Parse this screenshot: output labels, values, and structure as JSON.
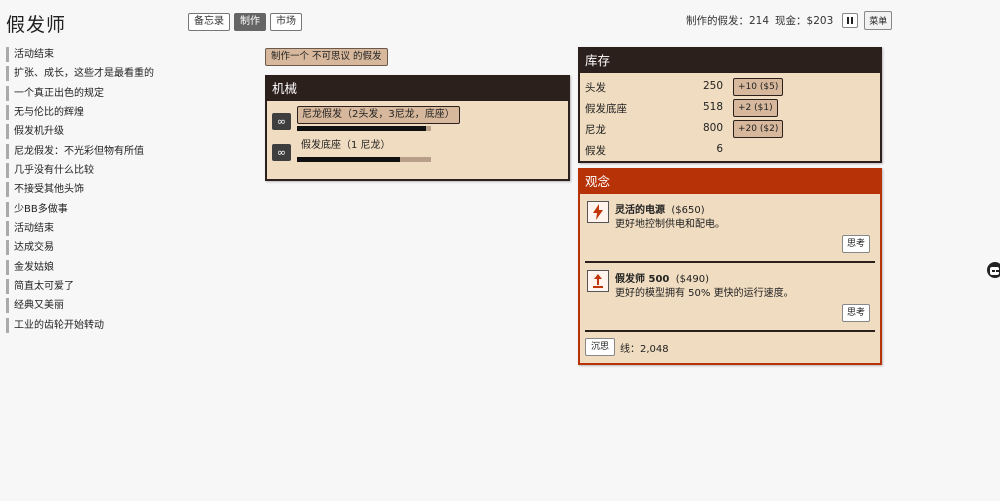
{
  "app": {
    "title": "假发师"
  },
  "tabs": [
    {
      "label": "备忘录",
      "active": false
    },
    {
      "label": "制作",
      "active": true
    },
    {
      "label": "市场",
      "active": false
    }
  ],
  "status": {
    "wigs_made_label": "制作的假发：",
    "wigs_made": "214",
    "cash_label": "现金：",
    "cash": "$203",
    "menu_label": "菜单"
  },
  "history": [
    "活动结束",
    "扩张、成长，这些才是最看重的",
    "一个真正出色的规定",
    "无与伦比的辉煌",
    "假发机升级",
    "尼龙假发：不光彩但物有所值",
    "几乎没有什么比较",
    "不接受其他头饰",
    "少BB多做事",
    "活动结束",
    "达成交易",
    "金发姑娘",
    "简直太可爱了",
    "经典又美丽",
    "工业的齿轮开始转动"
  ],
  "make_button": "制作一个 不可思议 的假发",
  "machines": {
    "title": "机械",
    "items": [
      {
        "label": "尼龙假发（2头发，3尼龙，底座）",
        "progress": 0.96,
        "icon": "infinity-icon"
      },
      {
        "label": "假发底座（1 尼龙）",
        "progress": 0.77,
        "icon": "infinity-icon"
      }
    ]
  },
  "inventory": {
    "title": "库存",
    "rows": [
      {
        "name": "头发",
        "count": "250",
        "buy": "+10 ($5)"
      },
      {
        "name": "假发底座",
        "count": "518",
        "buy": "+2 ($1)"
      },
      {
        "name": "尼龙",
        "count": "800",
        "buy": "+20 ($2)"
      },
      {
        "name": "假发",
        "count": "6",
        "buy": ""
      }
    ]
  },
  "ideas": {
    "title": "观念",
    "items": [
      {
        "name": "灵活的电源",
        "price": "($650)",
        "desc": "更好地控制供电和配电。",
        "button": "思考",
        "icon": "lightning-icon"
      },
      {
        "name": "假发师 500",
        "price": "($490)",
        "desc": "更好的模型拥有 50% 更快的运行速度。",
        "button": "思考",
        "icon": "upgrade-arrow-icon"
      }
    ],
    "ponder_label": "沉思",
    "lines_label": "线：",
    "lines_value": "2,048"
  },
  "colors": {
    "panel_dark": "#2b201c",
    "panel_bg": "#f0dcc0",
    "ideas_accent": "#b83208",
    "button_tan": "#d7b89c"
  }
}
